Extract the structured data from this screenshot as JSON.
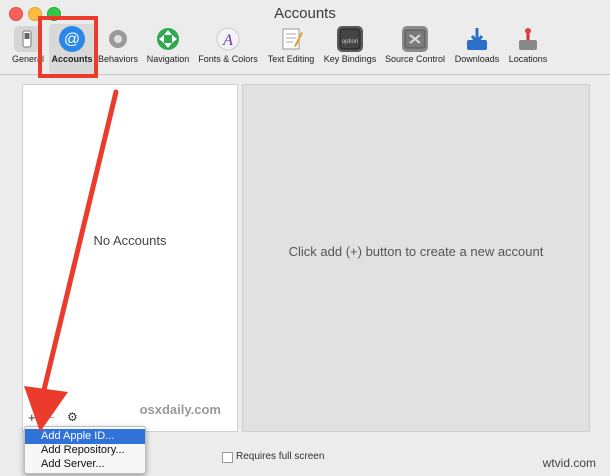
{
  "window": {
    "title": "Accounts"
  },
  "toolbar": {
    "items": [
      {
        "label": "General"
      },
      {
        "label": "Accounts"
      },
      {
        "label": "Behaviors"
      },
      {
        "label": "Navigation"
      },
      {
        "label": "Fonts & Colors"
      },
      {
        "label": "Text Editing"
      },
      {
        "label": "Key Bindings"
      },
      {
        "label": "Source Control"
      },
      {
        "label": "Downloads"
      },
      {
        "label": "Locations"
      }
    ]
  },
  "accounts_list": {
    "empty_text": "No Accounts",
    "plus": "+",
    "minus": "−",
    "gear": "⚙"
  },
  "detail": {
    "hint": "Click add (+) button to create a new account"
  },
  "add_menu": {
    "items": [
      {
        "label": "Add Apple ID...",
        "selected": true
      },
      {
        "label": "Add Repository...",
        "selected": false
      },
      {
        "label": "Add Server...",
        "selected": false
      }
    ]
  },
  "footer": {
    "requires_full_screen": "Requires full screen"
  },
  "watermarks": {
    "osxdaily": "osxdaily.com",
    "wtvid": "wtvid.com"
  },
  "colors": {
    "annotation_red": "#ea3b2c",
    "selection_blue": "#2f72d8"
  },
  "icons": {
    "toolbar": [
      "switch-icon",
      "at-sign-icon",
      "gear-icon",
      "navigation-arrows-icon",
      "fonts-colors-icon",
      "text-edit-icon",
      "key-bindings-icon",
      "source-control-icon",
      "download-icon",
      "locations-icon"
    ]
  }
}
